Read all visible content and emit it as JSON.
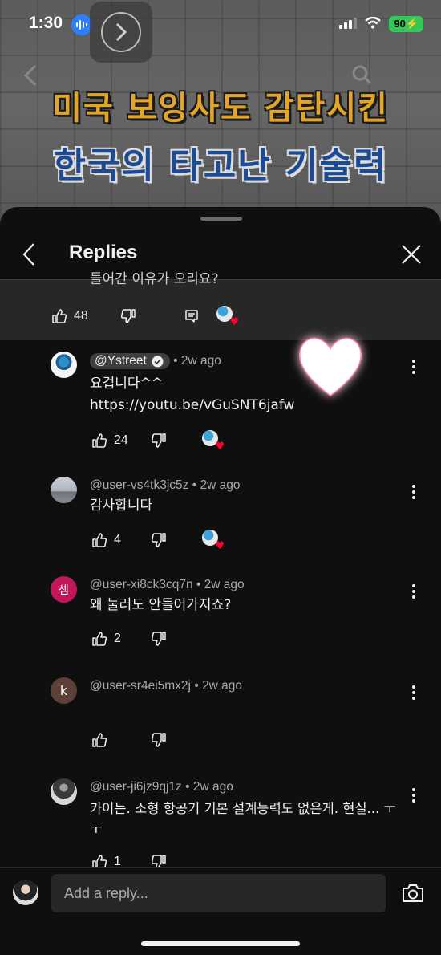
{
  "status_bar": {
    "time": "1:30",
    "battery": "90"
  },
  "thumbnail": {
    "line1": "미국 보잉사도 감탄시킨",
    "line2": "한국의 타고난 기술력"
  },
  "sheet": {
    "title": "Replies",
    "parent_comment_cut_text": "들어간 이유가 오리요?",
    "parent_likes": "48"
  },
  "replies": [
    {
      "handle": "@Ystreet",
      "verified": true,
      "time": "2w ago",
      "lines": [
        "요겁니다^^",
        "https://youtu.be/vGuSNT6jafw"
      ],
      "likes": "24",
      "creator_heart": true,
      "avatar_letter": ""
    },
    {
      "handle": "@user-vs4tk3jc5z",
      "time": "2w ago",
      "lines": [
        "감사합니다"
      ],
      "likes": "4",
      "creator_heart": true,
      "avatar_letter": ""
    },
    {
      "handle": "@user-xi8ck3cq7n",
      "time": "2w ago",
      "lines": [
        "왜 눌러도 안들어가지죠?"
      ],
      "likes": "2",
      "creator_heart": false,
      "avatar_letter": "셈"
    },
    {
      "handle": "@user-sr4ei5mx2j",
      "time": "2w ago",
      "lines": [],
      "likes": "",
      "creator_heart": false,
      "avatar_letter": "k"
    },
    {
      "handle": "@user-ji6jz9qj1z",
      "time": "2w ago",
      "lines": [
        "카이는. 소형 항공기 기본 설계능력도 없은게. 현실... ㅜ",
        "ㅜ"
      ],
      "likes": "1",
      "creator_heart": false,
      "avatar_letter": ""
    }
  ],
  "meta_sep": "•",
  "reply_input": {
    "placeholder": "Add a reply..."
  },
  "colors": {
    "heart": "#ff0033",
    "sheet_bg": "#0f0f0f",
    "parent_band": "#272727",
    "battery": "#34c759"
  },
  "icons": [
    "audio-wave-icon",
    "play-next-icon",
    "back-icon",
    "close-icon",
    "thumbs-up-icon",
    "thumbs-down-icon",
    "reply-icon",
    "more-vert-icon",
    "camera-icon",
    "verified-check-icon"
  ]
}
